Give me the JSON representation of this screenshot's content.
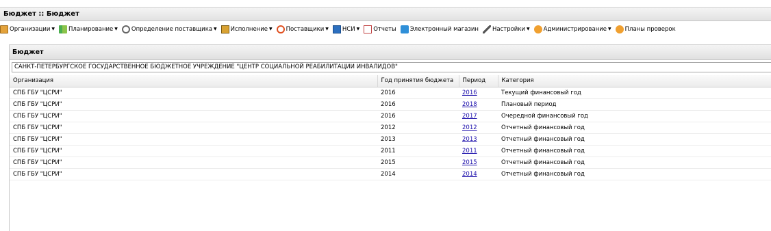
{
  "title": "Бюджет :: Бюджет",
  "menu": [
    {
      "label": "Организации",
      "icon": "folder-icon",
      "dropdown": true
    },
    {
      "label": "Планирование",
      "icon": "plan-icon",
      "dropdown": true
    },
    {
      "label": "Определение поставщика",
      "icon": "gears-icon",
      "dropdown": true
    },
    {
      "label": "Исполнение",
      "icon": "execution-icon",
      "dropdown": true
    },
    {
      "label": "Поставщики",
      "icon": "suppliers-icon",
      "dropdown": true
    },
    {
      "label": "НСИ",
      "icon": "nsi-icon",
      "dropdown": true
    },
    {
      "label": "Отчеты",
      "icon": "report-icon",
      "dropdown": false
    },
    {
      "label": "Электронный магазин",
      "icon": "shop-icon",
      "dropdown": false
    },
    {
      "label": "Настройки",
      "icon": "wrench-icon",
      "dropdown": true
    },
    {
      "label": "Администрирование",
      "icon": "user-icon",
      "dropdown": true
    },
    {
      "label": "Планы проверок",
      "icon": "user-icon",
      "dropdown": false
    }
  ],
  "panel": {
    "title": "Бюджет",
    "organization_value": "САНКТ-ПЕТЕРБУРГСКОЕ ГОСУДАРСТВЕННОЕ БЮДЖЕТНОЕ УЧРЕЖДЕНИЕ \"ЦЕНТР СОЦИАЛЬНОЙ РЕАБИЛИТАЦИИ ИНВАЛИДОВ\""
  },
  "table": {
    "columns": [
      "Организация",
      "Год принятия бюджета",
      "Период",
      "Категория"
    ],
    "rows": [
      [
        "СПБ ГБУ \"ЦСРИ\"",
        "2016",
        "2016",
        "Текущий финансовый год"
      ],
      [
        "СПБ ГБУ \"ЦСРИ\"",
        "2016",
        "2018",
        "Плановый период"
      ],
      [
        "СПБ ГБУ \"ЦСРИ\"",
        "2016",
        "2017",
        "Очередной финансовый год"
      ],
      [
        "СПБ ГБУ \"ЦСРИ\"",
        "2012",
        "2012",
        "Отчетный финансовый год"
      ],
      [
        "СПБ ГБУ \"ЦСРИ\"",
        "2013",
        "2013",
        "Отчетный финансовый год"
      ],
      [
        "СПБ ГБУ \"ЦСРИ\"",
        "2011",
        "2011",
        "Отчетный финансовый год"
      ],
      [
        "СПБ ГБУ \"ЦСРИ\"",
        "2015",
        "2015",
        "Отчетный финансовый год"
      ],
      [
        "СПБ ГБУ \"ЦСРИ\"",
        "2014",
        "2014",
        "Отчетный финансовый год"
      ]
    ]
  }
}
